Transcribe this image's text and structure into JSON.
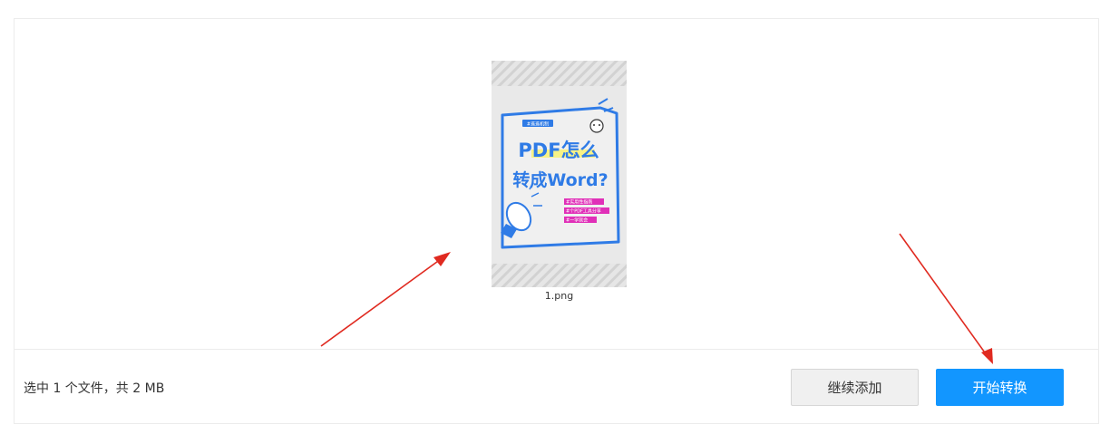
{
  "file": {
    "name": "1.png",
    "thumbnail": {
      "tag": "#逛逛机制",
      "title_line1": "PDF怎么",
      "title_line2": "转成Word?",
      "labels": [
        "#实用性指南",
        "#个PDF工具分享",
        "#一学就会"
      ]
    }
  },
  "footer": {
    "status_text": "选中 1 个文件，共 2 MB",
    "add_more_label": "继续添加",
    "start_label": "开始转换"
  },
  "colors": {
    "primary": "#1296ff",
    "arrow": "#e02a20"
  }
}
